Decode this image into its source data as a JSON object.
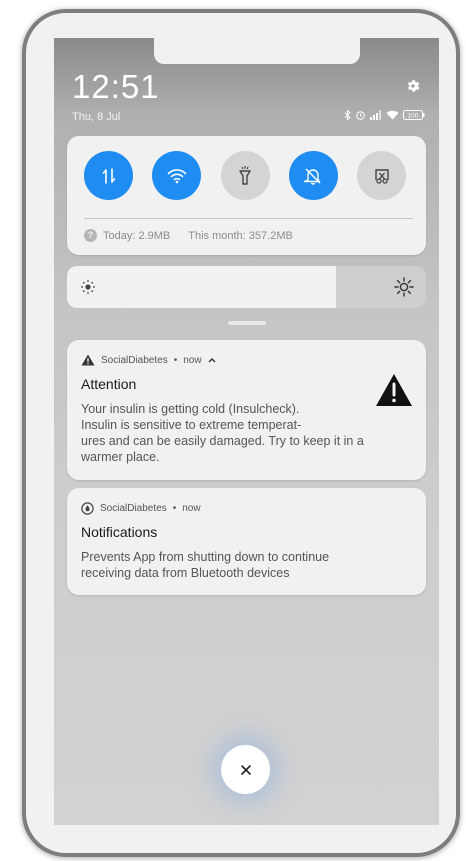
{
  "status_bar": {
    "time": "12:51",
    "date": "Thu, 8 Jul",
    "battery": "100",
    "icons": [
      "bluetooth-icon",
      "alarm-icon",
      "signal-icon",
      "wifi-icon",
      "battery-icon"
    ]
  },
  "quick_settings": {
    "tiles": [
      {
        "name": "mobile-data-icon",
        "state": "on"
      },
      {
        "name": "wifi-icon",
        "state": "on"
      },
      {
        "name": "flashlight-icon",
        "state": "off"
      },
      {
        "name": "silent-icon",
        "state": "on"
      },
      {
        "name": "screenshot-icon",
        "state": "off"
      }
    ],
    "data_usage": {
      "today": "Today: 2.9MB",
      "month": "This month: 357.2MB"
    },
    "colors": {
      "accent": "#1e8cf0",
      "tile_off": "#d4d4d4"
    }
  },
  "brightness": {
    "level": 0.75
  },
  "notifications": [
    {
      "app": "SocialDiabetes",
      "time": "now",
      "expanded": true,
      "title": "Attention",
      "body_lines": [
        "Your insulin is getting cold (Insulcheck).",
        "Insulin is sensitive to extreme temperat-",
        "ures and can be easily damaged. Try to keep it in a",
        "warmer place."
      ]
    },
    {
      "app": "SocialDiabetes",
      "time": "now",
      "title": "Notifications",
      "body_lines": [
        "Prevents App from shutting down to continue",
        "receiving data from Bluetooth devices"
      ]
    }
  ],
  "dismiss": {
    "icon": "close-icon"
  }
}
